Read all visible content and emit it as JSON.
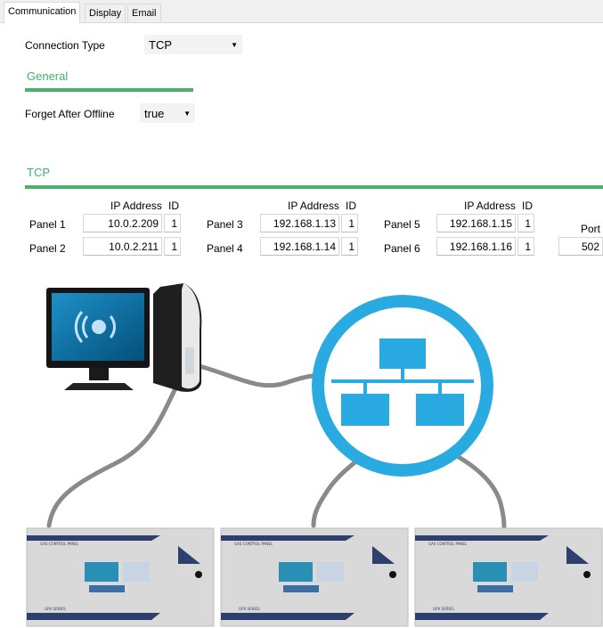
{
  "tabs": [
    "Communication",
    "Display",
    "Email"
  ],
  "connection": {
    "label": "Connection Type",
    "value": "TCP"
  },
  "general": {
    "title": "General",
    "forget_label": "Forget After Offline",
    "forget_value": "true"
  },
  "tcp": {
    "title": "TCP",
    "ip_header": "IP Address",
    "id_header": "ID",
    "port_label": "Port",
    "port_value": "502",
    "panels": [
      {
        "label": "Panel 1",
        "ip": "10.0.2.209",
        "id": "1"
      },
      {
        "label": "Panel 2",
        "ip": "10.0.2.211",
        "id": "1"
      },
      {
        "label": "Panel 3",
        "ip": "192.168.1.13",
        "id": "1"
      },
      {
        "label": "Panel 4",
        "ip": "192.168.1.14",
        "id": "1"
      },
      {
        "label": "Panel 5",
        "ip": "192.168.1.15",
        "id": "1"
      },
      {
        "label": "Panel 6",
        "ip": "192.168.1.16",
        "id": "1"
      }
    ]
  },
  "diagram": {
    "panel_device_title": "GAS CONTROL PANEL",
    "panel_device_series": "GPX SERIES"
  },
  "colors": {
    "accent_green": "#4caf6e",
    "network_blue": "#29abe2",
    "cable_gray": "#8a8a8a"
  }
}
